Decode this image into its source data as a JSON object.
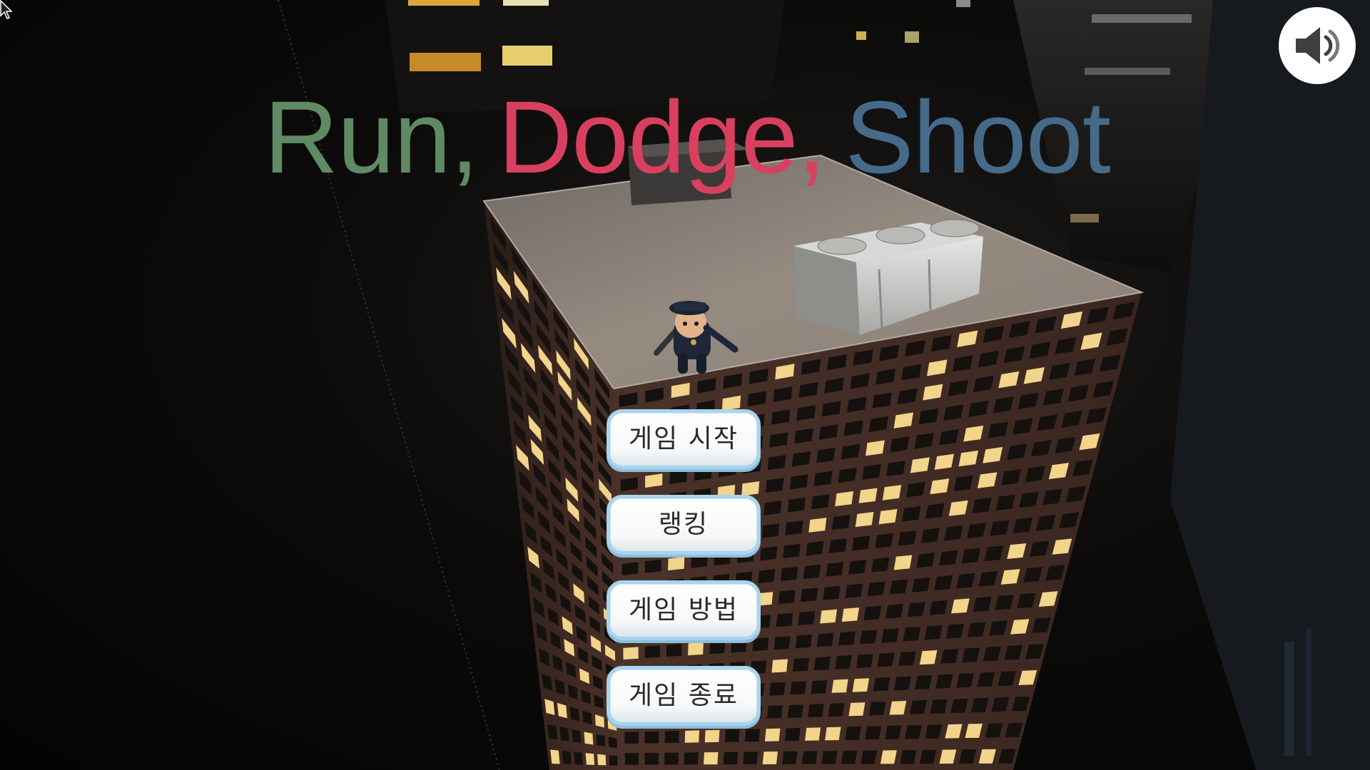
{
  "title": {
    "word1": "Run,",
    "word2": "Dodge,",
    "word3": "Shoot",
    "colors": {
      "word1": "#5f8a63",
      "word2": "#d9405f",
      "word3": "#466b8a"
    }
  },
  "menu": {
    "start_label": "게임 시작",
    "ranking_label": "랭킹",
    "howto_label": "게임 방법",
    "quit_label": "게임 종료"
  },
  "sound": {
    "icon": "speaker-volume-icon"
  },
  "colors": {
    "button_border": "#a8d4ee",
    "rooftop": "#8a8178",
    "building_facade": "#3e2a24",
    "window_lit": "#f2d48a"
  }
}
